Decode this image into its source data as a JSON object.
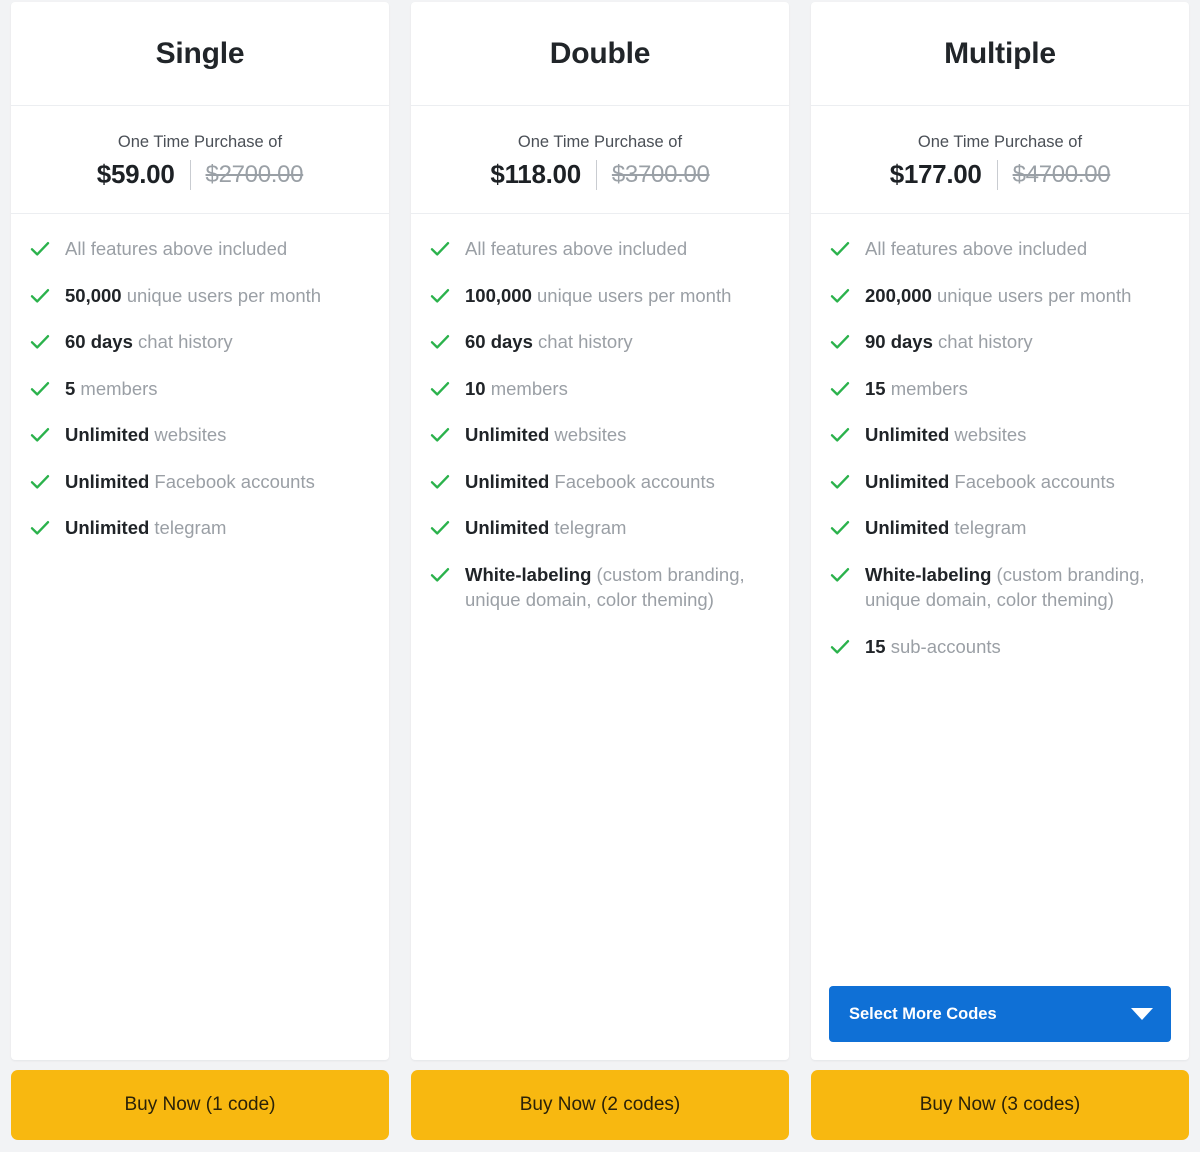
{
  "plans": [
    {
      "title": "Single",
      "price_caption": "One Time Purchase of",
      "price_now": "$59.00",
      "price_was": "$2700.00",
      "features": [
        {
          "strong": "",
          "rest": "All features above included"
        },
        {
          "strong": "50,000",
          "rest": " unique users per month"
        },
        {
          "strong": "60 days",
          "rest": " chat history"
        },
        {
          "strong": "5",
          "rest": " members"
        },
        {
          "strong": "Unlimited",
          "rest": " websites"
        },
        {
          "strong": "Unlimited",
          "rest": " Facebook accounts"
        },
        {
          "strong": "Unlimited",
          "rest": " telegram"
        }
      ],
      "has_more_codes": false,
      "more_codes_label": "",
      "buy_label": "Buy Now (1 code)"
    },
    {
      "title": "Double",
      "price_caption": "One Time Purchase of",
      "price_now": "$118.00",
      "price_was": "$3700.00",
      "features": [
        {
          "strong": "",
          "rest": "All features above included"
        },
        {
          "strong": "100,000",
          "rest": " unique users per month"
        },
        {
          "strong": "60 days",
          "rest": " chat history"
        },
        {
          "strong": "10",
          "rest": " members"
        },
        {
          "strong": "Unlimited",
          "rest": " websites"
        },
        {
          "strong": "Unlimited",
          "rest": " Facebook accounts"
        },
        {
          "strong": "Unlimited",
          "rest": " telegram"
        },
        {
          "strong": "White-labeling",
          "rest": " (custom branding, unique domain, color theming)"
        }
      ],
      "has_more_codes": false,
      "more_codes_label": "",
      "buy_label": "Buy Now (2 codes)"
    },
    {
      "title": "Multiple",
      "price_caption": "One Time Purchase of",
      "price_now": "$177.00",
      "price_was": "$4700.00",
      "features": [
        {
          "strong": "",
          "rest": "All features above included"
        },
        {
          "strong": "200,000",
          "rest": " unique users per month"
        },
        {
          "strong": "90 days",
          "rest": " chat history"
        },
        {
          "strong": "15",
          "rest": " members"
        },
        {
          "strong": "Unlimited",
          "rest": " websites"
        },
        {
          "strong": "Unlimited",
          "rest": " Facebook accounts"
        },
        {
          "strong": "Unlimited",
          "rest": " telegram"
        },
        {
          "strong": "White-labeling",
          "rest": " (custom branding, unique domain, color theming)"
        },
        {
          "strong": "15",
          "rest": " sub-accounts"
        }
      ],
      "has_more_codes": true,
      "more_codes_label": "Select More Codes",
      "buy_label": "Buy Now (3 codes)"
    }
  ],
  "icons": {
    "check": "check-icon",
    "caret": "chevron-down-icon"
  },
  "colors": {
    "check_green": "#2bb24c",
    "buy_yellow": "#f8b810",
    "more_codes_blue": "#0f70d6",
    "strong_text": "#202428",
    "muted_text": "#9a9fa5"
  }
}
